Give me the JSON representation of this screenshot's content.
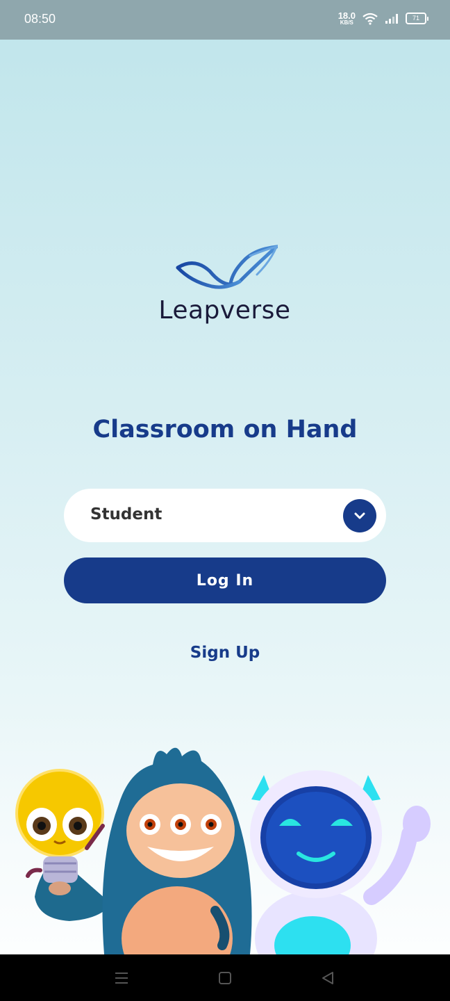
{
  "status_bar": {
    "time": "08:50",
    "net_speed_value": "18.0",
    "net_speed_unit": "KB/S",
    "battery": "71"
  },
  "brand": {
    "name": "Leapverse",
    "logo_icon": "wave-check-logo-icon"
  },
  "tagline": "Classroom on Hand",
  "role_select": {
    "selected": "Student",
    "icon": "chevron-down-icon"
  },
  "login_label": "Log In",
  "signup_label": "Sign Up",
  "nav_bar": {
    "menu_icon": "menu-icon",
    "home_icon": "home-square-icon",
    "back_icon": "back-triangle-icon"
  },
  "colors": {
    "primary": "#173b8a",
    "status_bar": "#8fa7ad",
    "background_top": "#bfe5eb",
    "background_bottom": "#ffffff"
  }
}
